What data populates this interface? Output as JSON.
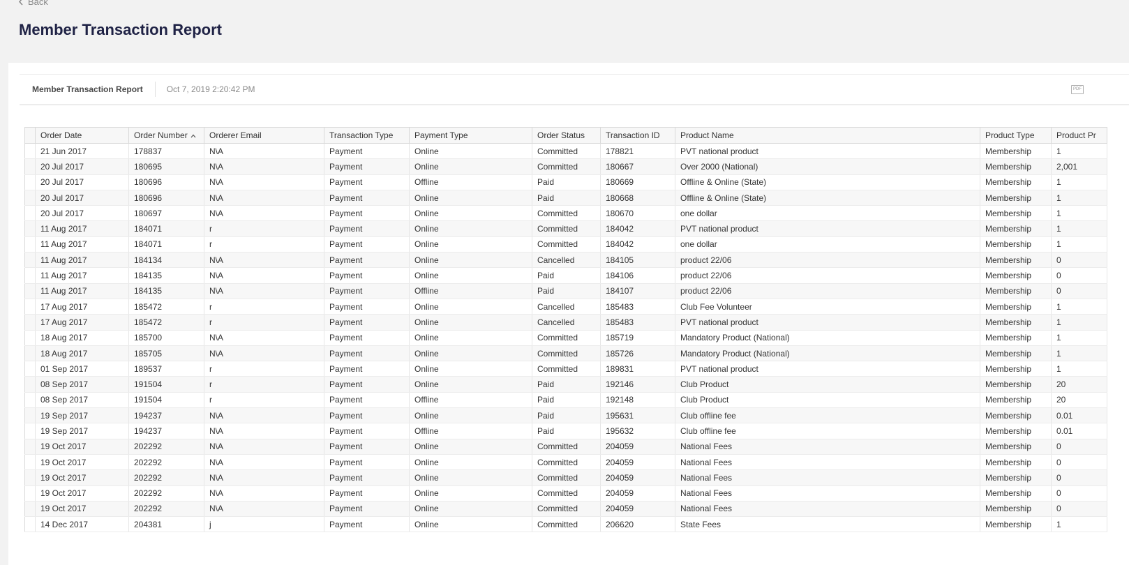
{
  "back": {
    "label": "Back"
  },
  "page_title": "Member Transaction Report",
  "report_bar": {
    "name": "Member Transaction Report",
    "timestamp": "Oct 7, 2019 2:20:42 PM",
    "pdf_label": "PDF"
  },
  "table": {
    "columns": [
      "Order Date",
      "Order Number",
      "Orderer Email",
      "Transaction Type",
      "Payment Type",
      "Order Status",
      "Transaction ID",
      "Product Name",
      "Product Type",
      "Product Pr"
    ],
    "sorted_column": "Order Number",
    "rows": [
      [
        "21 Jun 2017",
        "178837",
        "N\\A",
        "Payment",
        "Online",
        "Committed",
        "178821",
        "PVT national product",
        "Membership",
        "1"
      ],
      [
        "20 Jul 2017",
        "180695",
        "N\\A",
        "Payment",
        "Online",
        "Committed",
        "180667",
        "Over 2000 (National)",
        "Membership",
        "2,001"
      ],
      [
        "20 Jul 2017",
        "180696",
        "N\\A",
        "Payment",
        "Offline",
        "Paid",
        "180669",
        "Offline & Online (State)",
        "Membership",
        "1"
      ],
      [
        "20 Jul 2017",
        "180696",
        "N\\A",
        "Payment",
        "Online",
        "Paid",
        "180668",
        "Offline & Online (State)",
        "Membership",
        "1"
      ],
      [
        "20 Jul 2017",
        "180697",
        "N\\A",
        "Payment",
        "Online",
        "Committed",
        "180670",
        "one dollar",
        "Membership",
        "1"
      ],
      [
        "11 Aug 2017",
        "184071",
        "r",
        "Payment",
        "Online",
        "Committed",
        "184042",
        "PVT national product",
        "Membership",
        "1"
      ],
      [
        "11 Aug 2017",
        "184071",
        "r",
        "Payment",
        "Online",
        "Committed",
        "184042",
        "one dollar",
        "Membership",
        "1"
      ],
      [
        "11 Aug 2017",
        "184134",
        "N\\A",
        "Payment",
        "Online",
        "Cancelled",
        "184105",
        "product 22/06",
        "Membership",
        "0"
      ],
      [
        "11 Aug 2017",
        "184135",
        "N\\A",
        "Payment",
        "Online",
        "Paid",
        "184106",
        "product 22/06",
        "Membership",
        "0"
      ],
      [
        "11 Aug 2017",
        "184135",
        "N\\A",
        "Payment",
        "Offline",
        "Paid",
        "184107",
        "product 22/06",
        "Membership",
        "0"
      ],
      [
        "17 Aug 2017",
        "185472",
        "r",
        "Payment",
        "Online",
        "Cancelled",
        "185483",
        "Club Fee Volunteer",
        "Membership",
        "1"
      ],
      [
        "17 Aug 2017",
        "185472",
        "r",
        "Payment",
        "Online",
        "Cancelled",
        "185483",
        "PVT national product",
        "Membership",
        "1"
      ],
      [
        "18 Aug 2017",
        "185700",
        "N\\A",
        "Payment",
        "Online",
        "Committed",
        "185719",
        "Mandatory Product (National)",
        "Membership",
        "1"
      ],
      [
        "18 Aug 2017",
        "185705",
        "N\\A",
        "Payment",
        "Online",
        "Committed",
        "185726",
        "Mandatory Product (National)",
        "Membership",
        "1"
      ],
      [
        "01 Sep 2017",
        "189537",
        "r",
        "Payment",
        "Online",
        "Committed",
        "189831",
        "PVT national product",
        "Membership",
        "1"
      ],
      [
        "08 Sep 2017",
        "191504",
        "r",
        "Payment",
        "Online",
        "Paid",
        "192146",
        "Club Product",
        "Membership",
        "20"
      ],
      [
        "08 Sep 2017",
        "191504",
        "r",
        "Payment",
        "Offline",
        "Paid",
        "192148",
        "Club Product",
        "Membership",
        "20"
      ],
      [
        "19 Sep 2017",
        "194237",
        "N\\A",
        "Payment",
        "Online",
        "Paid",
        "195631",
        "Club offline fee",
        "Membership",
        "0.01"
      ],
      [
        "19 Sep 2017",
        "194237",
        "N\\A",
        "Payment",
        "Offline",
        "Paid",
        "195632",
        "Club offline fee",
        "Membership",
        "0.01"
      ],
      [
        "19 Oct 2017",
        "202292",
        "N\\A",
        "Payment",
        "Online",
        "Committed",
        "204059",
        "National Fees",
        "Membership",
        "0"
      ],
      [
        "19 Oct 2017",
        "202292",
        "N\\A",
        "Payment",
        "Online",
        "Committed",
        "204059",
        "National Fees",
        "Membership",
        "0"
      ],
      [
        "19 Oct 2017",
        "202292",
        "N\\A",
        "Payment",
        "Online",
        "Committed",
        "204059",
        "National Fees",
        "Membership",
        "0"
      ],
      [
        "19 Oct 2017",
        "202292",
        "N\\A",
        "Payment",
        "Online",
        "Committed",
        "204059",
        "National Fees",
        "Membership",
        "0"
      ],
      [
        "19 Oct 2017",
        "202292",
        "N\\A",
        "Payment",
        "Online",
        "Committed",
        "204059",
        "National Fees",
        "Membership",
        "0"
      ],
      [
        "14 Dec 2017",
        "204381",
        "j",
        "Payment",
        "Online",
        "Committed",
        "206620",
        "State Fees",
        "Membership",
        "1"
      ]
    ]
  }
}
